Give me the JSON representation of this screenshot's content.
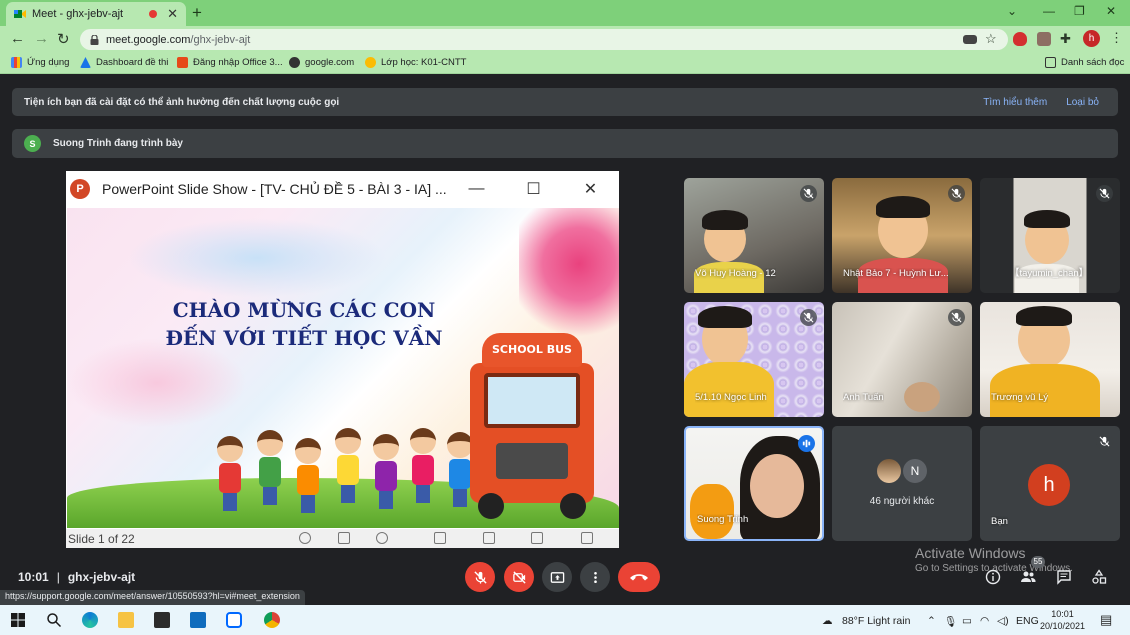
{
  "browser": {
    "tab_title": "Meet - ghx-jebv-ajt",
    "url_host": "meet.google.com",
    "url_path": "/ghx-jebv-ajt",
    "profile_initial": "h",
    "bookmarks": [
      "Ứng dụng",
      "Dashboard đề thi",
      "Đăng nhập Office 3...",
      "google.com",
      "Lớp học: K01-CNTT"
    ],
    "reading_list": "Danh sách đọc"
  },
  "banner": {
    "message": "Tiện ích bạn đã cài đặt có thể ảnh hưởng đến chất lượng cuộc gọi",
    "learn_more": "Tìm hiểu thêm",
    "remove": "Loại bỏ"
  },
  "presenting": {
    "avatar_initial": "S",
    "text": "Suong Trinh đang trình bày"
  },
  "ppt": {
    "logo": "P",
    "window_title": "PowerPoint Slide Show - [TV- CHỦ ĐỀ 5 - BÀI 3 - IA] ...",
    "slide_line1": "CHÀO MỪNG CÁC CON",
    "slide_line2": "ĐẾN VỚI TIẾT HỌC VẦN",
    "bus_sign": "SCHOOL BUS",
    "status": "Slide 1 of 22"
  },
  "participants": [
    {
      "name": "Võ Huy Hoàng - 12"
    },
    {
      "name": "Nhật Bảo 7 - Huỳnh Lư..."
    },
    {
      "name": "【tayumin_chan】"
    },
    {
      "name": "5/1.10 Ngọc Linh"
    },
    {
      "name": "Anh Tuấn"
    },
    {
      "name": "Trương vũ Lý"
    },
    {
      "name": "Suong Trinh"
    },
    {
      "name": "46 người khác",
      "mini_initial": "N"
    },
    {
      "name": "Bạn",
      "initial": "h"
    }
  ],
  "meeting": {
    "time": "10:01",
    "separator": "|",
    "code": "ghx-jebv-ajt",
    "people_count": "55"
  },
  "activate": {
    "line1": "Activate Windows",
    "line2": "Go to Settings to activate Windows."
  },
  "status_url": "https://support.google.com/meet/answer/10550593?hl=vi#meet_extension",
  "taskbar": {
    "weather": "88°F  Light rain",
    "lang": "ENG",
    "time": "10:01",
    "date": "20/10/2021"
  },
  "colors": {
    "chrome_green": "#7ed07a",
    "meet_bg": "#202124",
    "danger": "#ea4335"
  }
}
